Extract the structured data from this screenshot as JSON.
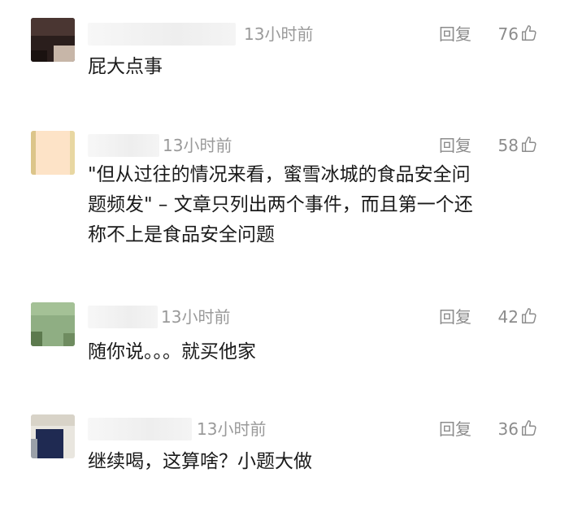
{
  "comments": [
    {
      "time": "13小时前",
      "reply": "回复",
      "likes": "76",
      "text": "屁大点事"
    },
    {
      "time": "13小时前",
      "reply": "回复",
      "likes": "58",
      "text": "\"但从过往的情况来看，蜜雪冰城的食品安全问\n题频发\" – 文章只列出两个事件，而且第一个还\n称不上是食品安全问题"
    },
    {
      "time": "13小时前",
      "reply": "回复",
      "likes": "42",
      "text": "随你说。。。就买他家"
    },
    {
      "time": "13小时前",
      "reply": "回复",
      "likes": "36",
      "text": "继续喝，这算啥？小题大做"
    }
  ],
  "icons": {
    "like": "thumbs-up-icon"
  }
}
